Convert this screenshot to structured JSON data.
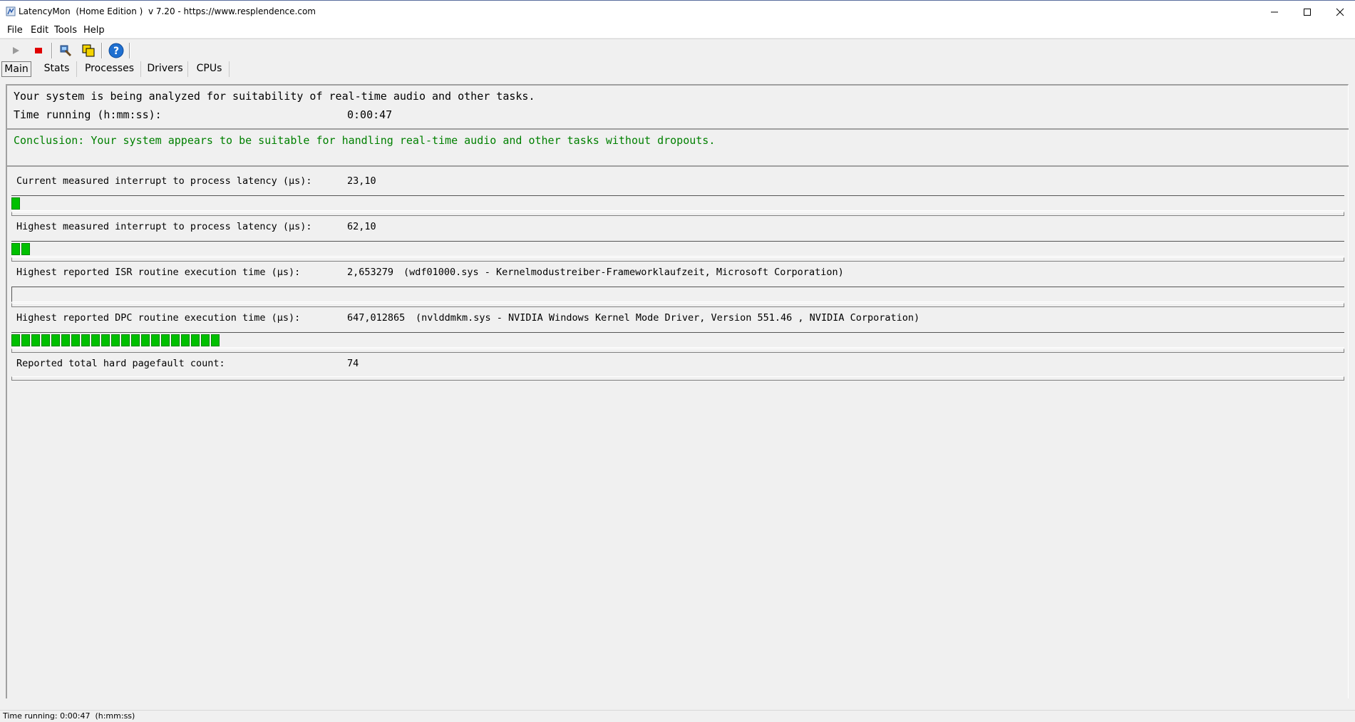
{
  "window": {
    "title": "LatencyMon  (Home Edition )  v 7.20 - https://www.resplendence.com",
    "icon": "latencymon-app-icon"
  },
  "menu": [
    "File",
    "Edit",
    "Tools",
    "Help"
  ],
  "toolbar": {
    "buttons": [
      "play-icon",
      "stop-icon",
      "drivers-icon",
      "processes-icon",
      "help-icon"
    ],
    "colors": {
      "stop": "#e00000",
      "help": "#1e6fd0",
      "bar": "#00c000"
    }
  },
  "tabs": [
    "Main",
    "Stats",
    "Processes",
    "Drivers",
    "CPUs"
  ],
  "main": {
    "analyze_text": "Your system is being analyzed for suitability of real-time audio and other tasks.",
    "time_running_label": "Time running (h:mm:ss):",
    "time_running_value": "0:00:47",
    "conclusion": "Conclusion: Your system appears to be suitable for handling real-time audio and other tasks without dropouts.",
    "rows": [
      {
        "label": "Current measured interrupt to process latency (µs):",
        "value": "23,10",
        "detail": "",
        "segments": 1
      },
      {
        "label": "Highest measured interrupt to process latency (µs):",
        "value": "62,10",
        "detail": "",
        "segments": 2
      },
      {
        "label": "Highest reported ISR routine execution time (µs):",
        "value": "2,653279",
        "detail": "(wdf01000.sys - Kernelmodustreiber-Frameworklaufzeit, Microsoft Corporation)",
        "segments": 0
      },
      {
        "label": "Highest reported DPC routine execution time (µs):",
        "value": "647,012865",
        "detail": "(nvlddmkm.sys - NVIDIA Windows Kernel Mode Driver, Version 551.46 , NVIDIA Corporation)",
        "segments": 21
      },
      {
        "label": "Reported total hard pagefault count:",
        "value": "74",
        "detail": "",
        "segments": null
      }
    ]
  },
  "status": "Time running: 0:00:47  (h:mm:ss)"
}
